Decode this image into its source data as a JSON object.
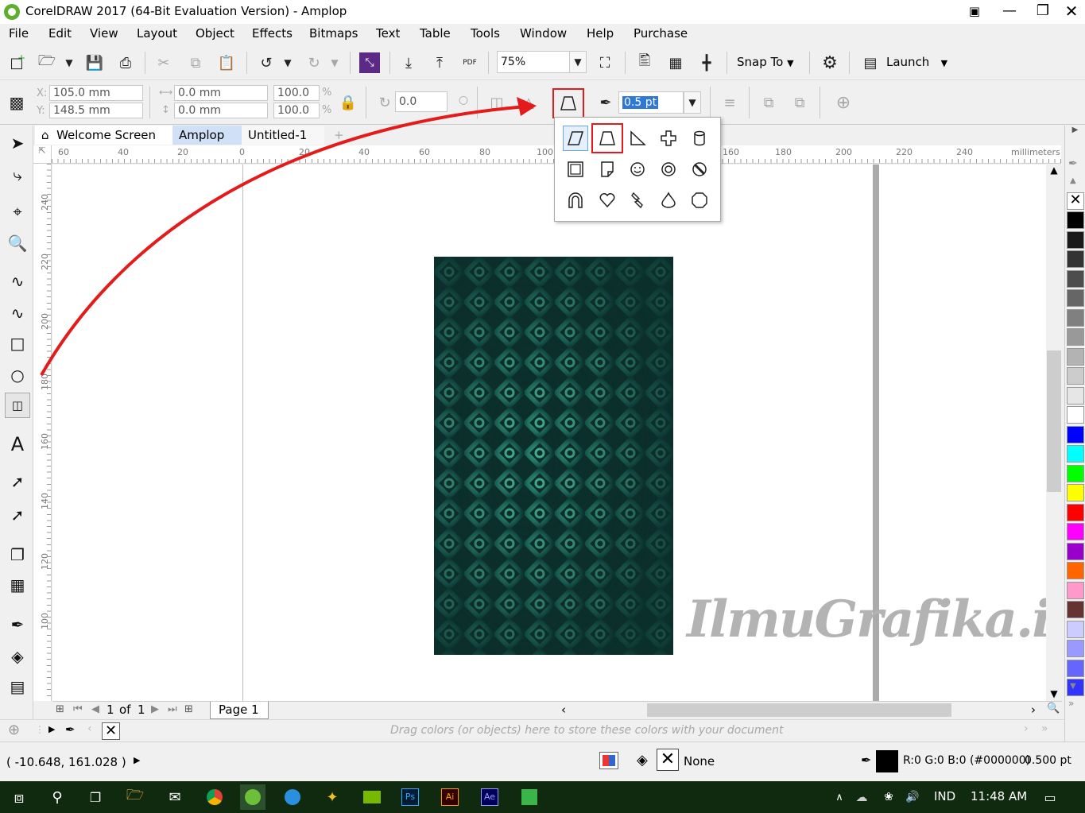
{
  "window": {
    "title": "CorelDRAW 2017 (64-Bit Evaluation Version) - Amplop"
  },
  "menu": [
    "File",
    "Edit",
    "View",
    "Layout",
    "Object",
    "Effects",
    "Bitmaps",
    "Text",
    "Table",
    "Tools",
    "Window",
    "Help",
    "Purchase"
  ],
  "toolbar": {
    "zoom": "75%",
    "snap_to": "Snap To",
    "launch": "Launch",
    "pdf_label": "PDF"
  },
  "property_bar": {
    "x": "105.0 mm",
    "y": "148.5 mm",
    "width": "0.0 mm",
    "height": "0.0 mm",
    "scale_w": "100.0",
    "scale_h": "100.0",
    "percent": "%",
    "rotation": "0.0",
    "outline_width": "0.5 pt",
    "x_label": "X:",
    "y_label": "Y:"
  },
  "tabs": [
    "Welcome Screen",
    "Amplop",
    "Untitled-1"
  ],
  "ruler": {
    "unit": "millimeters",
    "h_labels": [
      "60",
      "40",
      "20",
      "0",
      "20",
      "40",
      "60",
      "80",
      "100",
      "160",
      "180",
      "200",
      "220",
      "240"
    ],
    "v_labels": [
      "240",
      "220",
      "200",
      "180",
      "160",
      "140",
      "120",
      "100"
    ]
  },
  "page_nav": {
    "current": "1",
    "of_label": "of",
    "total": "1",
    "page_tab": "Page 1"
  },
  "doc_palette_hint": "Drag colors (or objects) here to store these colors with your document",
  "status": {
    "coords": "( -10.648, 161.028 )",
    "fill": "None",
    "outline_color": "R:0 G:0 B:0 (#000000)",
    "outline_width": "0.500 pt"
  },
  "watermark": "IlmuGrafika.id",
  "taskbar": {
    "language": "IND",
    "time": "11:48 AM",
    "apps": [
      "Ps",
      "Ai",
      "Ae"
    ]
  },
  "palette_colors": [
    "#000000",
    "#1a1a1a",
    "#333333",
    "#4d4d4d",
    "#666666",
    "#808080",
    "#999999",
    "#b3b3b3",
    "#cccccc",
    "#e6e6e6",
    "#ffffff",
    "#0000ff",
    "#00ffff",
    "#00ff00",
    "#ffff00",
    "#ff0000",
    "#ff00ff",
    "#9900cc",
    "#ff6600",
    "#ff99cc",
    "#663333",
    "#ccccff",
    "#9999ff",
    "#6666ff",
    "#3333ff"
  ],
  "colors": {
    "accent_red": "#e31b1b",
    "pattern_dark": "#0c3a36",
    "pattern_light": "#4fd4ae",
    "taskbar": "#0f2a0f"
  }
}
